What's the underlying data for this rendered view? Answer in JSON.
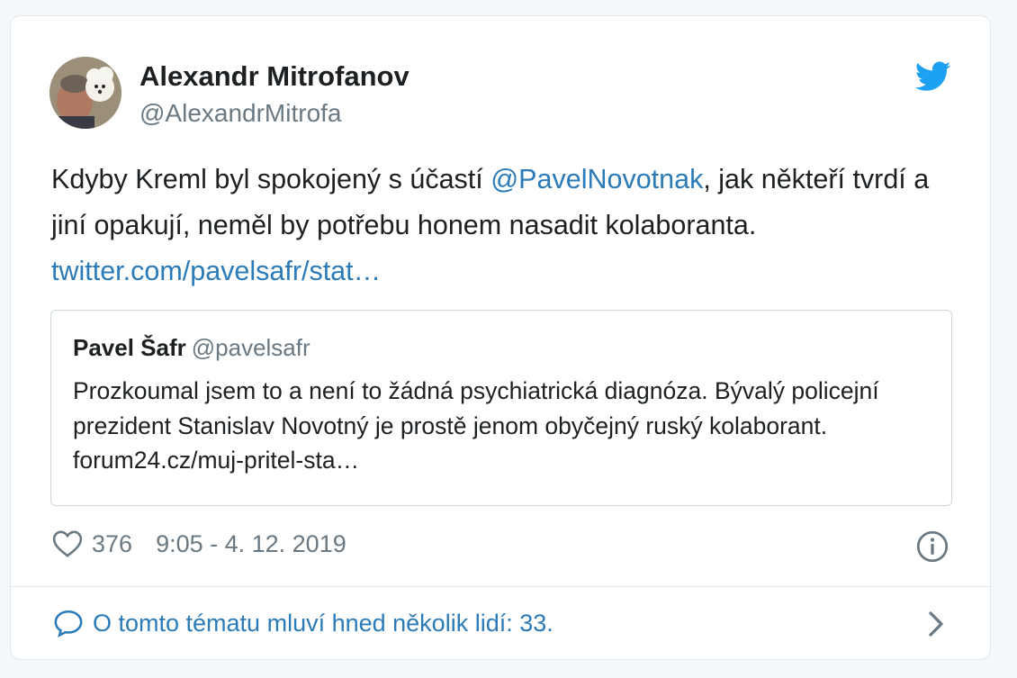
{
  "author": {
    "name": "Alexandr Mitrofanov",
    "handle": "@AlexandrMitrofa"
  },
  "tweet": {
    "text_part1": "Kdyby Kreml byl spokojený s účastí ",
    "mention": "@PavelNovotnak",
    "text_part2": ", jak někteří tvrdí a jiní opakují, neměl by potřebu honem nasadit kolaboranta. ",
    "link": "twitter.com/pavelsafr/stat…"
  },
  "quoted": {
    "name": "Pavel Šafr",
    "handle": "@pavelsafr",
    "text": "Prozkoumal jsem to a není to žádná psychiatrická diagnóza. Bývalý policejní prezident Stanislav Novotný je prostě jenom obyčejný ruský kolaborant. forum24.cz/muj-pritel-sta…"
  },
  "footer": {
    "likes": "376",
    "timestamp": "9:05 - 4. 12. 2019"
  },
  "conversation": {
    "label": "O tomto tématu mluví hned několik lidí: 33."
  },
  "icons": {
    "brand": "twitter-bird-icon",
    "like": "heart-icon",
    "info": "info-icon",
    "reply": "speech-bubble-icon",
    "more": "chevron-right-icon"
  },
  "colors": {
    "link": "#2b7bb9",
    "brand": "#1da1f2",
    "muted": "#697882",
    "text": "#1c2022",
    "border": "#e1e8ed"
  }
}
